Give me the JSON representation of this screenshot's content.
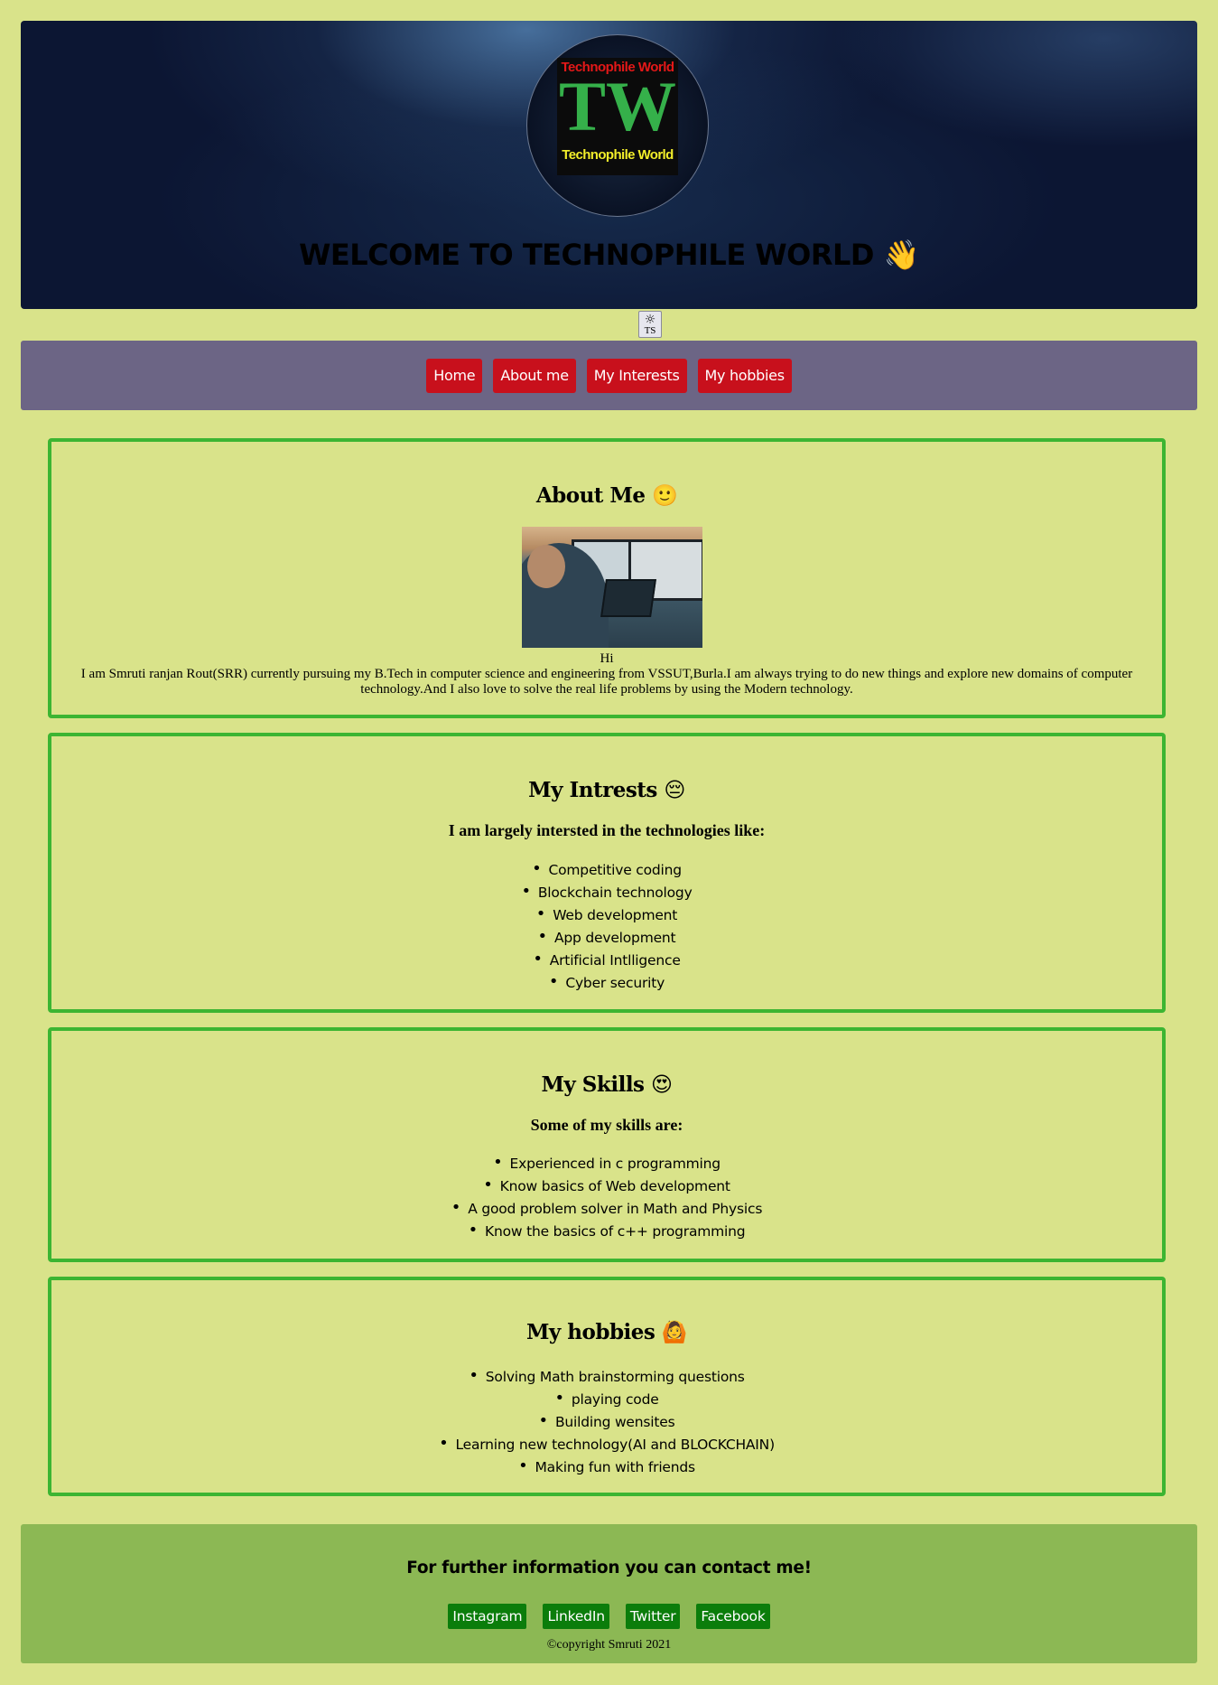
{
  "header": {
    "logo_top_text": "Technophile World",
    "logo_main_text": "TW",
    "logo_bottom_text": "Technophile World",
    "welcome": "WELCOME TO TECHNOPHILE WORLD",
    "welcome_emoji": "👋"
  },
  "theme_toggle": {
    "icon": "sun-icon",
    "label": "TS"
  },
  "nav": {
    "items": [
      "Home",
      "About me",
      "My Interests",
      "My hobbies"
    ]
  },
  "about": {
    "title": "About Me",
    "emoji": "🙂",
    "image": "person-at-computer-photo",
    "greeting": "Hi",
    "text": "I am Smruti ranjan Rout(SRR) currently pursuing my B.Tech in computer science and engineering from VSSUT,Burla.I am always trying to do new things and explore new domains of computer technology.And I also love to solve the real life problems by using the Modern technology."
  },
  "interests": {
    "title": "My Intrests",
    "emoji": "😔",
    "subtitle": "I am largely intersted in the technologies like:",
    "items": [
      "Competitive coding",
      "Blockchain technology",
      "Web development",
      "App development",
      "Artificial Intlligence",
      "Cyber security"
    ]
  },
  "skills": {
    "title": "My Skills",
    "emoji": "😍",
    "subtitle": "Some of my skills are:",
    "items": [
      "Experienced in c programming",
      "Know basics of Web development",
      "A good problem solver in Math and Physics",
      "Know the basics of c++ programming"
    ]
  },
  "hobbies": {
    "title": "My hobbies",
    "emoji": "🙆",
    "items": [
      "Solving Math brainstorming questions",
      "playing code",
      "Building wensites",
      "Learning new technology(AI and BLOCKCHAIN)",
      "Making fun with friends"
    ]
  },
  "footer": {
    "title": "For further information you can contact me!",
    "links": [
      "Instagram",
      "LinkedIn",
      "Twitter",
      "Facebook"
    ],
    "copyright": "©copyright Smruti 2021"
  },
  "colors": {
    "page_bg": "#d9e38a",
    "header_bg": "#0c1633",
    "nav_bg": "#6c6585",
    "nav_button": "#c8101c",
    "section_border": "#3cb532",
    "footer_bg": "#8cb854",
    "footer_button": "#0b7d0b"
  }
}
